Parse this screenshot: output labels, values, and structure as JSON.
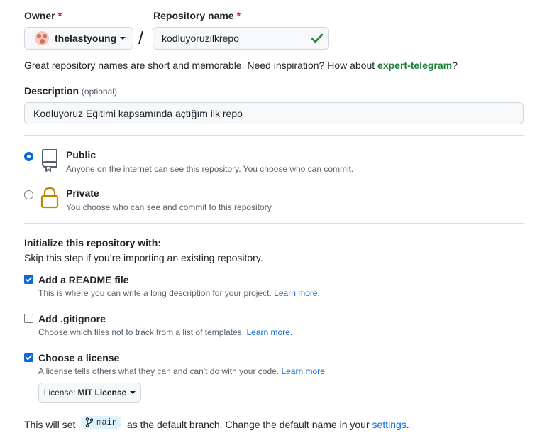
{
  "owner": {
    "label": "Owner",
    "required_mark": "*",
    "username": "thelastyoung"
  },
  "separator": "/",
  "repo": {
    "label": "Repository name",
    "required_mark": "*",
    "value": "kodluyoruzilkrepo"
  },
  "name_help": {
    "text": "Great repository names are short and memorable. Need inspiration? How about ",
    "suggestion": "expert-telegram",
    "suffix": "?"
  },
  "description": {
    "label": "Description",
    "optional": "(optional)",
    "value": "Kodluyoruz Eğitimi kapsamında açtığım ilk repo"
  },
  "visibility": {
    "public": {
      "title": "Public",
      "desc": "Anyone on the internet can see this repository. You choose who can commit.",
      "selected": true
    },
    "private": {
      "title": "Private",
      "desc": "You choose who can see and commit to this repository.",
      "selected": false
    }
  },
  "init": {
    "heading": "Initialize this repository with:",
    "subheading": "Skip this step if you’re importing an existing repository.",
    "readme": {
      "title": "Add a README file",
      "desc": "This is where you can write a long description for your project.",
      "link": "Learn more.",
      "checked": true
    },
    "gitignore": {
      "title": "Add .gitignore",
      "desc": "Choose which files not to track from a list of templates.",
      "link": "Learn more.",
      "checked": false
    },
    "license": {
      "title": "Choose a license",
      "desc": "A license tells others what they can and can't do with your code.",
      "link": "Learn more.",
      "checked": true,
      "button_prefix": "License:",
      "button_value": "MIT License"
    }
  },
  "branch_note": {
    "prefix": "This will set",
    "branch": "main",
    "middle": "as the default branch. Change the default name in your",
    "link": "settings",
    "suffix": "."
  },
  "colors": {
    "accent": "#0969da",
    "success": "#1a7f37",
    "required": "#cf222e",
    "lock": "#bf8700"
  }
}
